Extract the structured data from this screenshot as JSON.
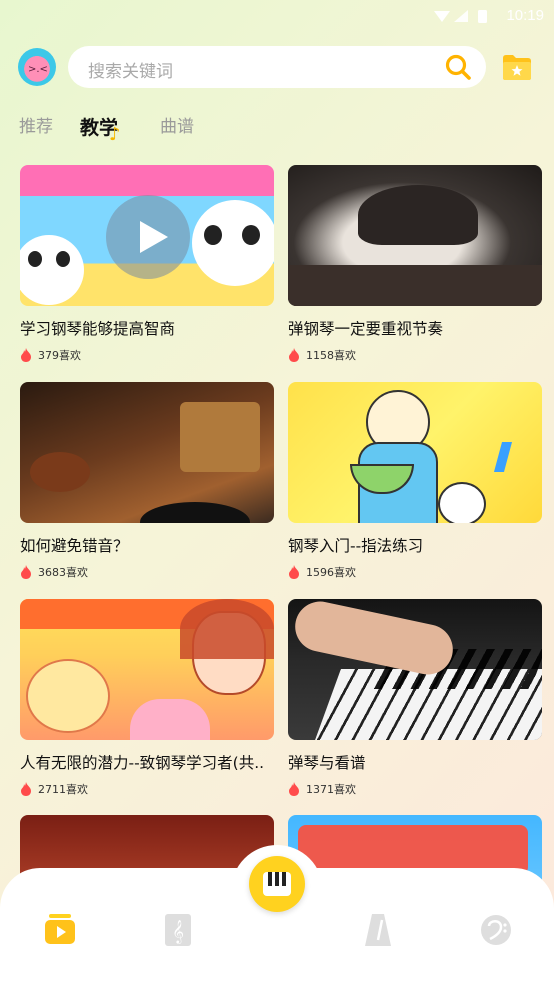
{
  "status": {
    "time": "10:19"
  },
  "search": {
    "placeholder": "搜索关键词"
  },
  "tabs": [
    {
      "label": "推荐"
    },
    {
      "label": "教学"
    },
    {
      "label": "曲谱"
    }
  ],
  "cards": [
    {
      "title": "学习钢琴能够提高智商",
      "likes": "379喜欢"
    },
    {
      "title": "弹钢琴一定要重视节奏",
      "likes": "1158喜欢"
    },
    {
      "title": "如何避免错音？",
      "likes": "3683喜欢"
    },
    {
      "title": "钢琴入门--指法练习",
      "likes": "1596喜欢"
    },
    {
      "title": "人有无限的潜力--致钢琴学习者(共..",
      "likes": "2711喜欢"
    },
    {
      "title": "弹琴与看谱",
      "likes": "1371喜欢"
    }
  ],
  "colors": {
    "accent": "#ffd21f",
    "flame": "#ff4b4b"
  },
  "icons": {
    "search": "search-icon",
    "folder": "star-folder-icon",
    "piano": "piano-icon",
    "nav": [
      "video-icon",
      "sheet-music-icon",
      "metronome-icon",
      "bass-clef-icon"
    ]
  }
}
